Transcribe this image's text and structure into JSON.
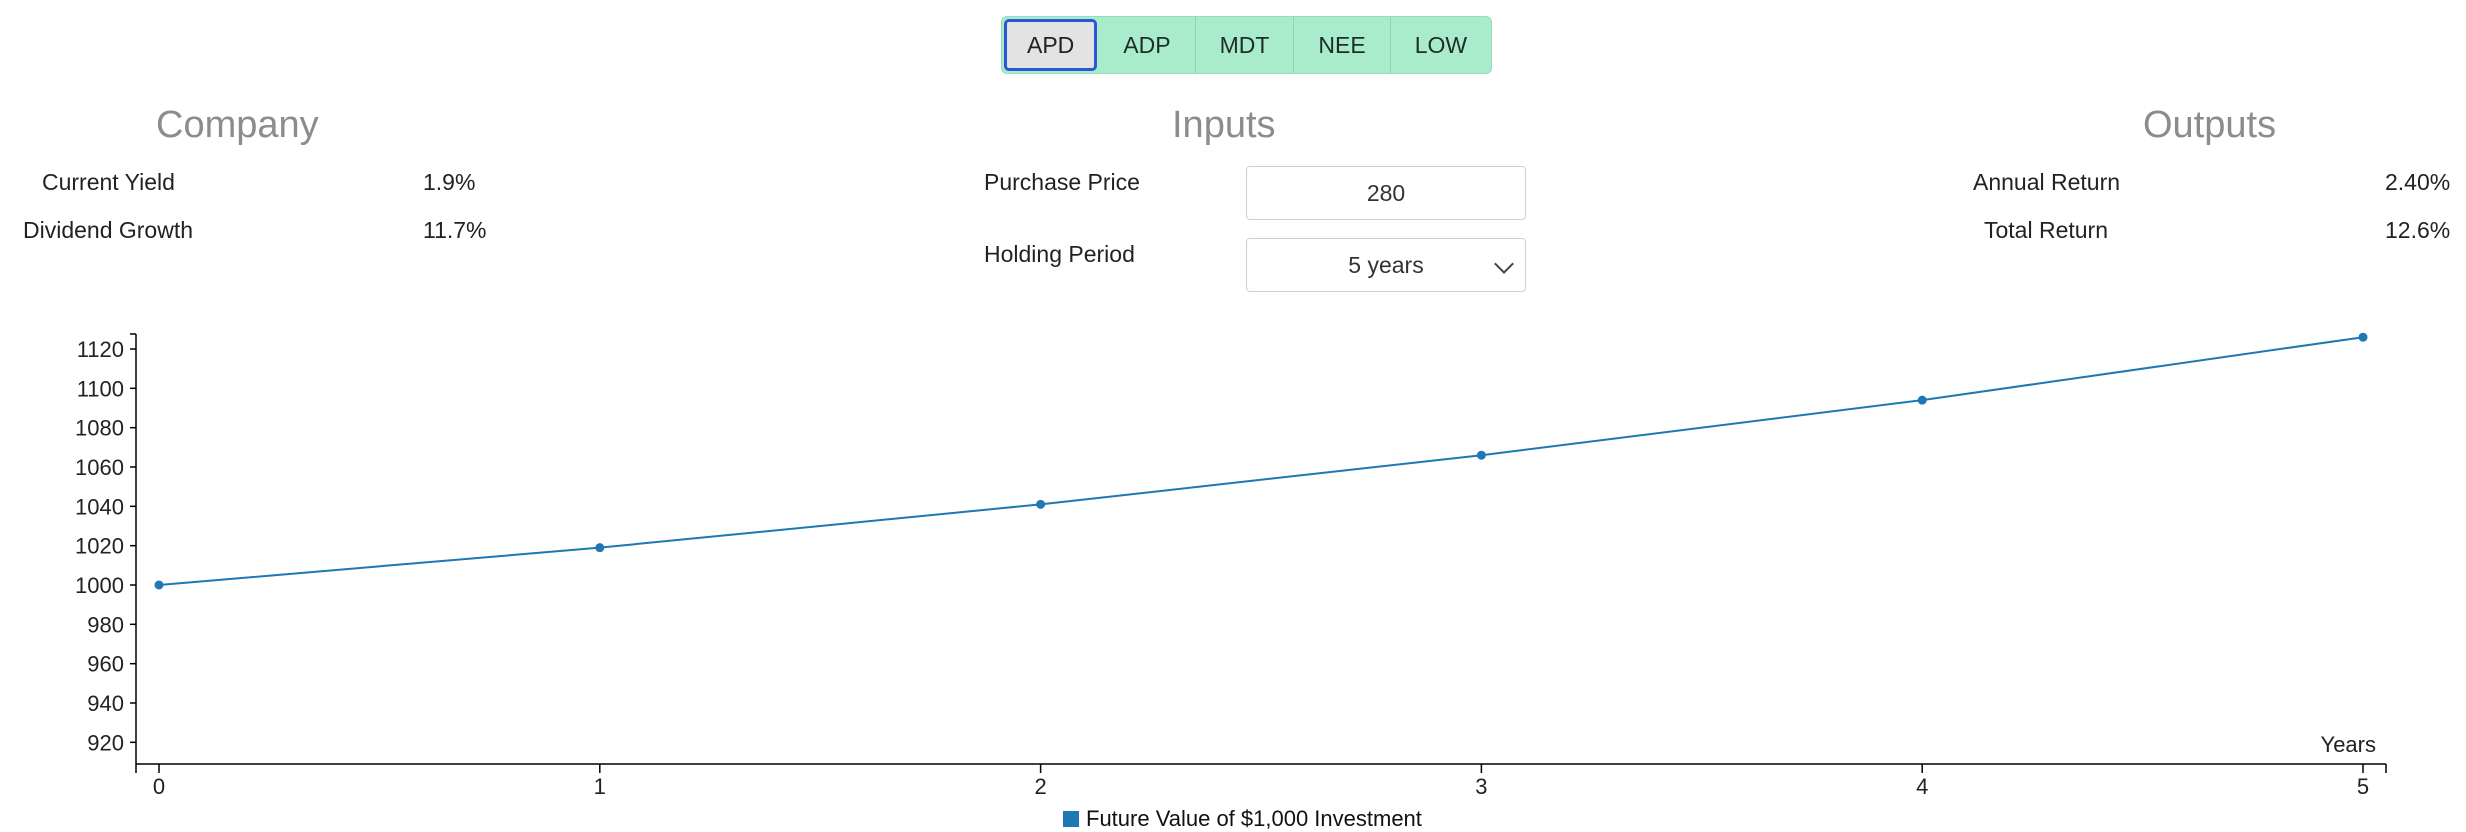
{
  "tickers": [
    {
      "label": "APD",
      "active": true
    },
    {
      "label": "ADP",
      "active": false
    },
    {
      "label": "MDT",
      "active": false
    },
    {
      "label": "NEE",
      "active": false
    },
    {
      "label": "LOW",
      "active": false
    }
  ],
  "company": {
    "title": "Company",
    "current_yield_label": "Current Yield",
    "current_yield_value": "1.9%",
    "dividend_growth_label": "Dividend Growth",
    "dividend_growth_value": "11.7%"
  },
  "inputs": {
    "title": "Inputs",
    "purchase_price_label": "Purchase Price",
    "purchase_price_value": "280",
    "holding_period_label": "Holding Period",
    "holding_period_value": "5 years"
  },
  "outputs": {
    "title": "Outputs",
    "annual_return_label": "Annual Return",
    "annual_return_value": "2.40%",
    "total_return_label": "Total Return",
    "total_return_value": "12.6%"
  },
  "colors": {
    "accent": "#1f77b4",
    "ticker_bg": "#a8eccb",
    "active_border": "#2a57d6"
  },
  "chart_data": {
    "type": "line",
    "x": [
      0,
      1,
      2,
      3,
      4,
      5
    ],
    "series": [
      {
        "name": "Future Value of $1,000 Investment",
        "values": [
          1000,
          1019,
          1041,
          1066,
          1094,
          1126
        ]
      }
    ],
    "xlabel": "Years",
    "ylabel": "",
    "xlim": [
      0,
      5
    ],
    "ylim": [
      910,
      1130
    ],
    "yticks": [
      920,
      940,
      960,
      980,
      1000,
      1020,
      1040,
      1060,
      1080,
      1100,
      1120
    ],
    "xticks": [
      0,
      1,
      2,
      3,
      4,
      5
    ],
    "grid": false,
    "legend": "bottom-center"
  }
}
